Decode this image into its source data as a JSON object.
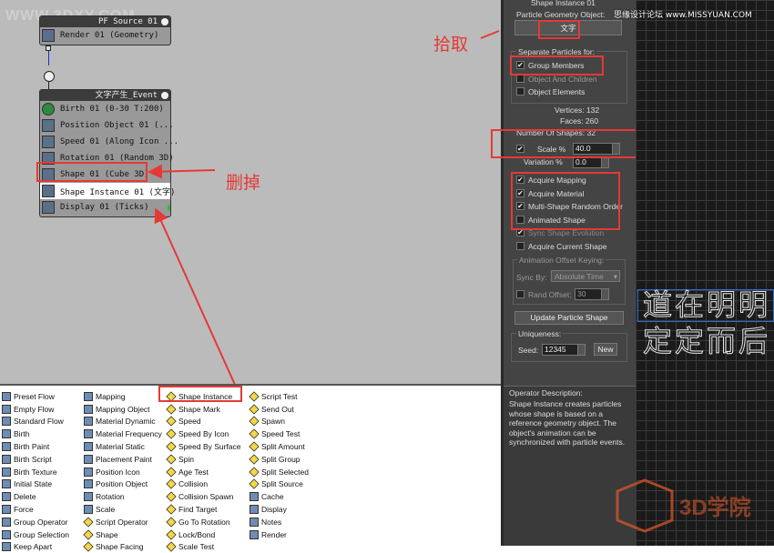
{
  "watermark": "WWW.3DXY.COM",
  "header_right": "思缘设计论坛 www.MISSYUAN.COM",
  "source_node": {
    "title": "PF Source 01",
    "rows": [
      "Render 01 (Geometry)"
    ]
  },
  "event_node": {
    "title": "文字产生_Event",
    "rows": [
      "Birth 01 (0-30 T:200)",
      "Position Object 01 (...",
      "Speed 01 (Along Icon ...",
      "Rotation 01 (Random 3D)",
      "Shape 01 (Cube 3D)",
      "Shape Instance 01 (文字)",
      "Display 01 (Ticks)"
    ]
  },
  "annotations": {
    "pick": "拾取",
    "delete": "删掉"
  },
  "panel": {
    "rollout_title": "Shape Instance 01",
    "geometry_label": "Particle Geometry Object:",
    "geometry_value": "文字",
    "separate_label": "Separate Particles for:",
    "group_members": "Group Members",
    "object_children": "Object And Children",
    "object_elements": "Object Elements",
    "vertices": "Vertices: 132",
    "faces": "Faces: 260",
    "num_shapes": "Number Of Shapes: 32",
    "scale_label": "Scale %",
    "scale_value": "40.0",
    "variation_label": "Variation %",
    "variation_value": "0.0",
    "acquire_mapping": "Acquire Mapping",
    "acquire_material": "Acquire Material",
    "multi_shape": "Multi-Shape Random Order",
    "animated_shape": "Animated Shape",
    "sync_evolution": "Sync Shape Evolution",
    "acquire_current": "Acquire Current Shape",
    "anim_offset_label": "Animation Offset Keying:",
    "sync_by_label": "Sync By:",
    "sync_by_value": "Absolute Time",
    "rand_offset_label": "Rand Offset:",
    "rand_offset_value": "30",
    "update_button": "Update Particle Shape",
    "uniqueness_label": "Uniqueness:",
    "seed_label": "Seed:",
    "seed_value": "12345",
    "new_button": "New",
    "desc_title": "Operator Description:",
    "desc_text": "Shape Instance creates particles whose shape is based on a reference geometry object. The object's animation can be synchronized with particle events."
  },
  "viewport_text": [
    "道在明明",
    "定定而后"
  ],
  "logo_text": "3D学院",
  "depot": {
    "col1": [
      "Preset Flow",
      "Empty Flow",
      "Standard Flow",
      "Birth",
      "Birth Paint",
      "Birth Script",
      "Birth Texture",
      "Initial State",
      "Delete",
      "Force",
      "Group Operator",
      "Group Selection",
      "Keep Apart"
    ],
    "col2": [
      "Mapping",
      "Mapping Object",
      "Material Dynamic",
      "Material Frequency",
      "Material Static",
      "Placement Paint",
      "Position Icon",
      "Position Object",
      "Rotation",
      "Scale",
      "Script Operator",
      "Shape",
      "Shape Facing"
    ],
    "col3": [
      "Shape Instance",
      "Shape Mark",
      "Speed",
      "Speed By Icon",
      "Speed By Surface",
      "Spin",
      "Age Test",
      "Collision",
      "Collision Spawn",
      "Find Target",
      "Go To Rotation",
      "Lock/Bond",
      "Scale Test"
    ],
    "col4": [
      "Script Test",
      "Send Out",
      "Spawn",
      "Speed Test",
      "Split Amount",
      "Split Group",
      "Split Selected",
      "Split Source",
      "Cache",
      "Display",
      "Notes",
      "Render"
    ]
  }
}
